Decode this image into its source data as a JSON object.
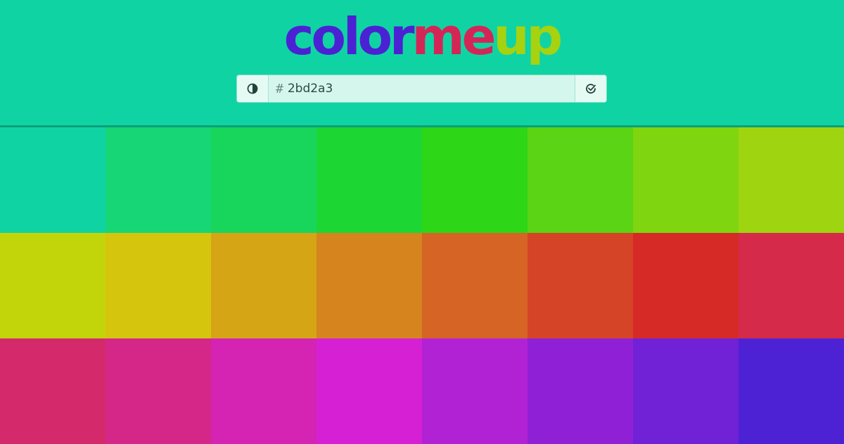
{
  "logo": {
    "parts": [
      {
        "text": "color",
        "color": "#4a22d4"
      },
      {
        "text": "me",
        "color": "#d42656"
      },
      {
        "text": "up",
        "color": "#a6d20f"
      }
    ]
  },
  "search": {
    "hash": "#",
    "value": "2bd2a3",
    "left_icon": "contrast-icon",
    "right_icon": "check-icon"
  },
  "colors": {
    "background": "#10d3a3",
    "divider": "#0b9f7b"
  },
  "swatches": [
    "#10d3a3",
    "#17d676",
    "#18d55b",
    "#1cd634",
    "#2dd616",
    "#5ad414",
    "#7ed510",
    "#9fd410",
    "#c2d40a",
    "#d5c50d",
    "#d5a516",
    "#d6841d",
    "#d66425",
    "#d64428",
    "#d62a26",
    "#d52a4a",
    "#d42a6b",
    "#d42788",
    "#d523b3",
    "#d520d4",
    "#b122d4",
    "#9020d6",
    "#7121d6",
    "#4d22d4"
  ]
}
